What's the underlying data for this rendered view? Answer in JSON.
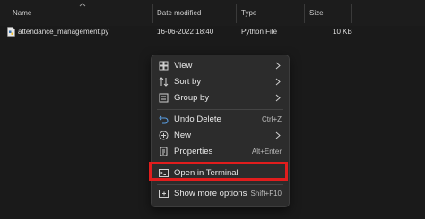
{
  "columns": {
    "name": "Name",
    "date_modified": "Date modified",
    "type": "Type",
    "size": "Size"
  },
  "file": {
    "name": "attendance_management.py",
    "date_modified": "16-06-2022 18:40",
    "type": "Python File",
    "size": "10 KB"
  },
  "context_menu": {
    "items": [
      {
        "label": "View",
        "icon": "view-icon",
        "submenu": true
      },
      {
        "label": "Sort by",
        "icon": "sort-icon",
        "submenu": true
      },
      {
        "label": "Group by",
        "icon": "group-icon",
        "submenu": true
      },
      {
        "label": "Undo Delete",
        "icon": "undo-icon",
        "shortcut": "Ctrl+Z"
      },
      {
        "label": "New",
        "icon": "new-icon",
        "submenu": true
      },
      {
        "label": "Properties",
        "icon": "properties-icon",
        "shortcut": "Alt+Enter"
      },
      {
        "label": "Open in Terminal",
        "icon": "terminal-icon",
        "highlighted": true
      },
      {
        "label": "Show more options",
        "icon": "more-options-icon",
        "shortcut": "Shift+F10"
      }
    ]
  },
  "colors": {
    "background": "#1a1a1a",
    "menu_background": "#2c2c2c",
    "highlight_border": "#e11d1d"
  }
}
